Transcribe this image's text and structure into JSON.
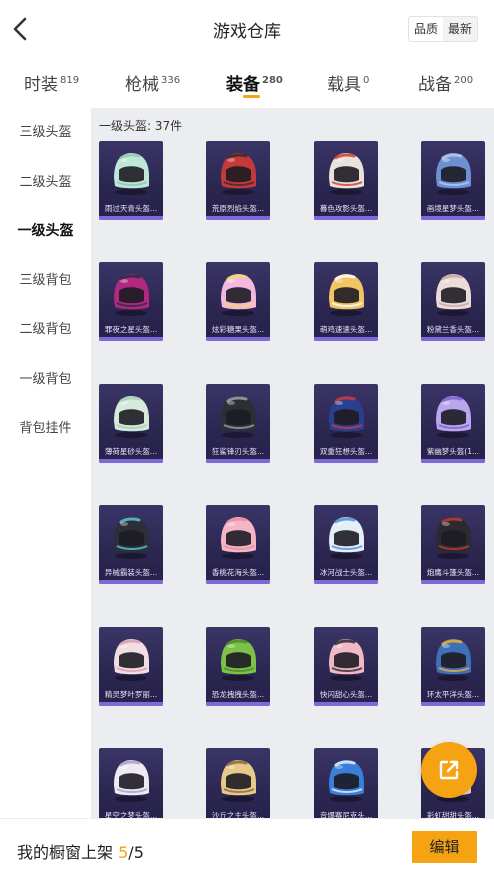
{
  "header": {
    "title": "游戏仓库",
    "sort_options": [
      "品质",
      "最新"
    ],
    "sort_active": 0
  },
  "tabs": [
    {
      "label": "时装",
      "count": "819"
    },
    {
      "label": "枪械",
      "count": "336"
    },
    {
      "label": "装备",
      "count": "280",
      "active": true
    },
    {
      "label": "载具",
      "count": "0"
    },
    {
      "label": "战备",
      "count": "200"
    }
  ],
  "sidebar": {
    "items": [
      {
        "label": "三级头盔"
      },
      {
        "label": "二级头盔"
      },
      {
        "label": "一级头盔",
        "active": true
      },
      {
        "label": "三级背包"
      },
      {
        "label": "二级背包"
      },
      {
        "label": "一级背包"
      },
      {
        "label": "背包挂件"
      }
    ]
  },
  "main": {
    "category_title": "一级头盔: 37件",
    "items": [
      {
        "name": "雨过天青头盔...",
        "color": "#bfe6d6",
        "accent": "#8fc7b2"
      },
      {
        "name": "荒原烈焰头盔...",
        "color": "#c23a3a",
        "accent": "#3a2a2a"
      },
      {
        "name": "暮色攻影头盔...",
        "color": "#e8e2dc",
        "accent": "#d23a2a"
      },
      {
        "name": "画境星梦头盔...",
        "color": "#6d8fd4",
        "accent": "#b8c8ee"
      },
      {
        "name": "罪夜之星头盔...",
        "color": "#b1297f",
        "accent": "#2a2a44"
      },
      {
        "name": "炫彩糖果头盔...",
        "color": "#f2b9dd",
        "accent": "#f3d85a"
      },
      {
        "name": "萌鸡速速头盔...",
        "color": "#f1c466",
        "accent": "#ffffff"
      },
      {
        "name": "粉黛兰香头盔...",
        "color": "#eadcd8",
        "accent": "#c9a6a0"
      },
      {
        "name": "薄荷星砂头盔...",
        "color": "#d6eadc",
        "accent": "#a9cdb4"
      },
      {
        "name": "狂鲨锋刃头盔...",
        "color": "#2c2f36",
        "accent": "#9aa3ad"
      },
      {
        "name": "双重狂想头盔...",
        "color": "#2b3f8f",
        "accent": "#d43a3a"
      },
      {
        "name": "紫幽梦头盔(1...",
        "color": "#b9a6ee",
        "accent": "#7e62cc"
      },
      {
        "name": "异械霸装头盔...",
        "color": "#2c2f36",
        "accent": "#58c8d6"
      },
      {
        "name": "香桃花海头盔...",
        "color": "#f4b6c5",
        "accent": "#e98ba2"
      },
      {
        "name": "冰河战士头盔...",
        "color": "#e3eef8",
        "accent": "#4f8ed2"
      },
      {
        "name": "炮鹰斗篷头盔...",
        "color": "#2c2a30",
        "accent": "#c23a3a"
      },
      {
        "name": "精灵梦叶罗丽...",
        "color": "#f2dde2",
        "accent": "#d99cb0"
      },
      {
        "name": "恐龙拽拽头盔...",
        "color": "#7ec14a",
        "accent": "#4b8a2a"
      },
      {
        "name": "快闪甜心头盔...",
        "color": "#f2b8c6",
        "accent": "#2a2a30"
      },
      {
        "name": "环太平洋头盔...",
        "color": "#3f6fb8",
        "accent": "#f0b030"
      },
      {
        "name": "星空之梦头盔...",
        "color": "#eeeaf2",
        "accent": "#a89ec8"
      },
      {
        "name": "沙丘之主头盔...",
        "color": "#e7c98a",
        "accent": "#8a6a3a"
      },
      {
        "name": "音爆赛尼克头...",
        "color": "#3a7fd8",
        "accent": "#e8f0fa"
      },
      {
        "name": "彩虹甜甜头盔...",
        "color": "#f3c9d8",
        "accent": "#a6d8f2"
      }
    ]
  },
  "fab": {
    "icon": "share-external-icon",
    "color": "#f5a313"
  },
  "footer": {
    "label": "我的橱窗上架",
    "current": "5",
    "separator": "/",
    "total": "5",
    "edit_label": "编辑",
    "accent": "#f5a313"
  }
}
